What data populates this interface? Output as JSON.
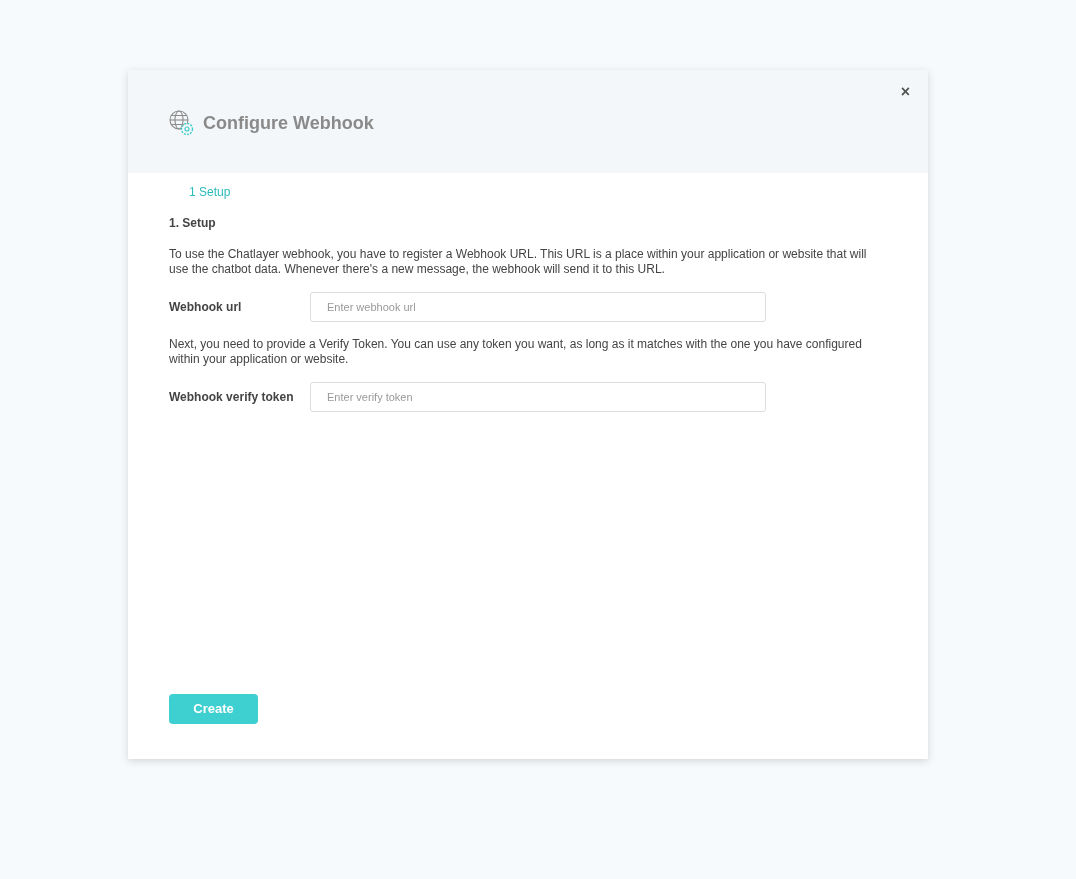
{
  "dialog": {
    "title": "Configure Webhook",
    "close": "×"
  },
  "steps": [
    {
      "label": "1 Setup",
      "selected": true
    }
  ],
  "section": {
    "heading": "1. Setup",
    "blocks": [
      {
        "kind": "text",
        "text": "To use the Chatlayer webhook, you have to register a Webhook URL. This URL is a place within your application or website that will use the chatbot data. Whenever there's a new message, the webhook will send it to this URL."
      },
      {
        "kind": "field",
        "label": "Webhook url",
        "placeholder": "Enter webhook url"
      },
      {
        "kind": "text",
        "text": "Next, you need to provide a Verify Token. You can use any token you want, as long as it matches with the one you have configured within your application or website."
      },
      {
        "kind": "field",
        "label": "Webhook verify token",
        "placeholder": "Enter verify token"
      }
    ]
  },
  "buttons": [
    "Create"
  ]
}
